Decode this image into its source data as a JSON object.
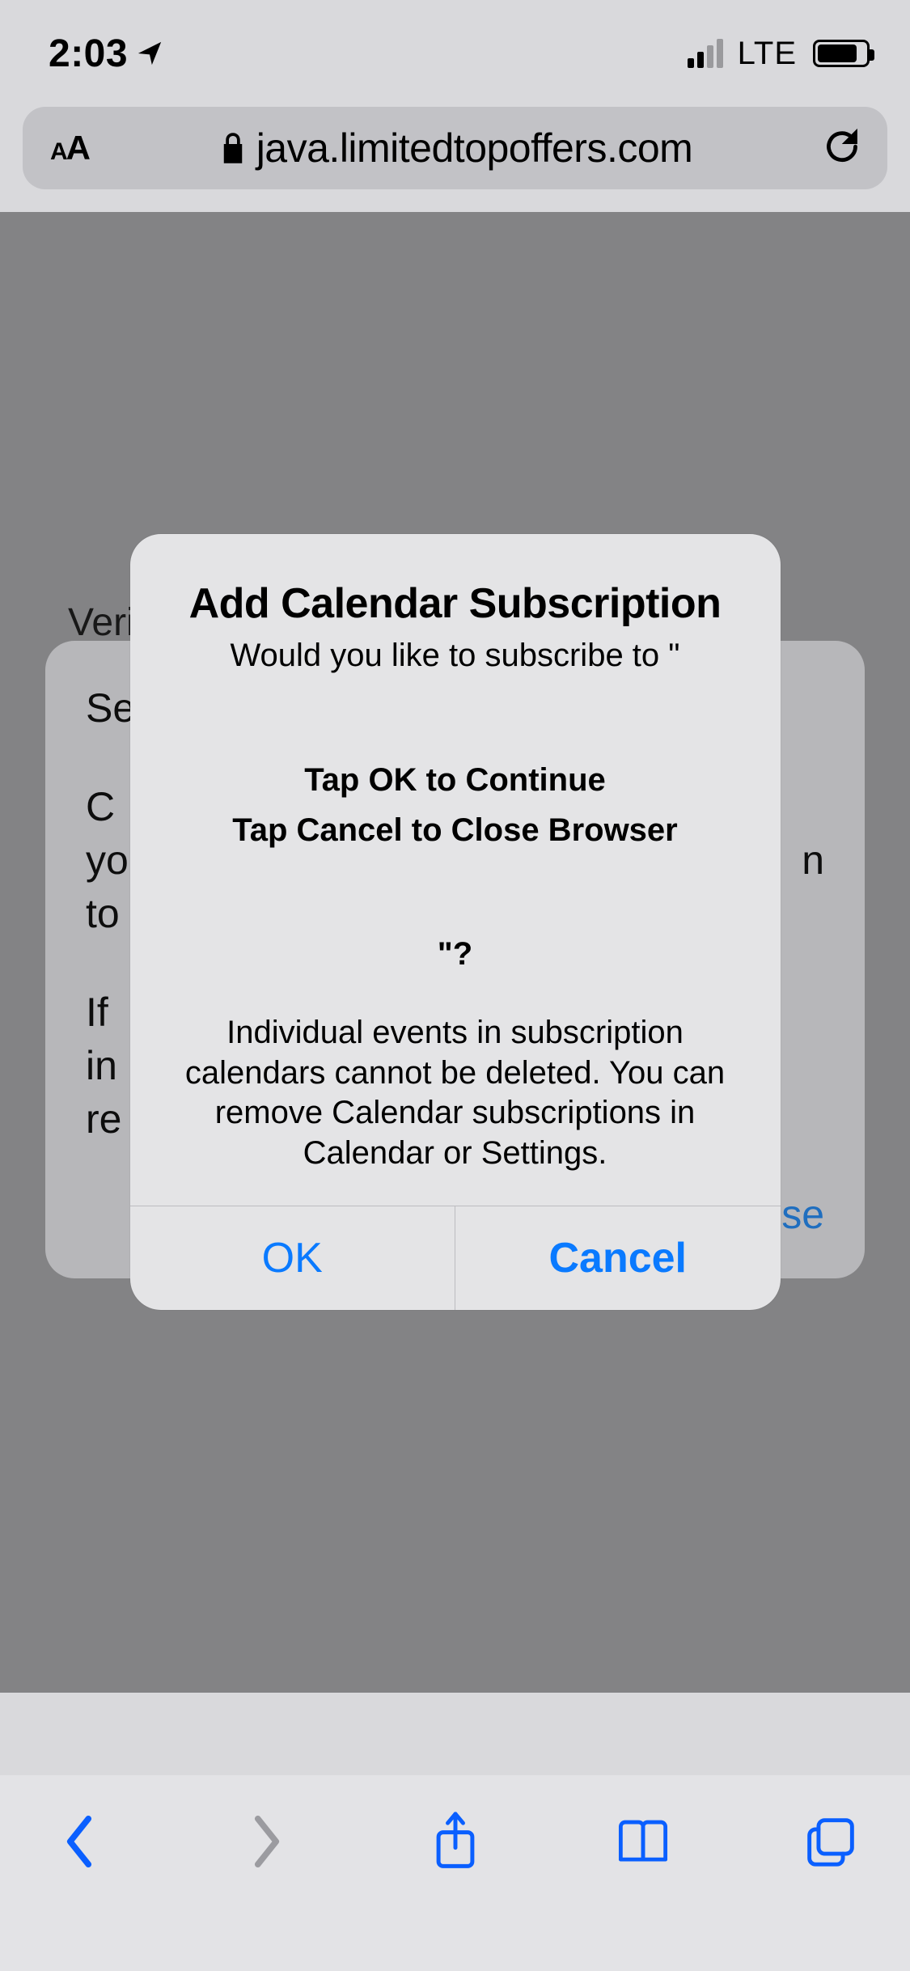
{
  "status": {
    "time": "2:03",
    "network_label": "LTE"
  },
  "urlbar": {
    "domain": "java.limitedtopoffers.com"
  },
  "page": {
    "verify": "Veri",
    "line1": "Se",
    "line2": "C",
    "line3": "yo",
    "line4": "to",
    "line5": "If",
    "line6": "in",
    "line7": "re",
    "right1": "n",
    "link": "se"
  },
  "modal": {
    "title": "Add Calendar Subscription",
    "subtitle": "Would you like to subscribe to \"",
    "mid1": "Tap OK to Continue",
    "mid2": "Tap Cancel to Close Browser",
    "question_suffix": "\"?",
    "info": "Individual events in subscription calendars cannot be deleted. You can remove Calendar subscriptions in Calendar or Settings.",
    "ok_label": "OK",
    "cancel_label": "Cancel"
  }
}
